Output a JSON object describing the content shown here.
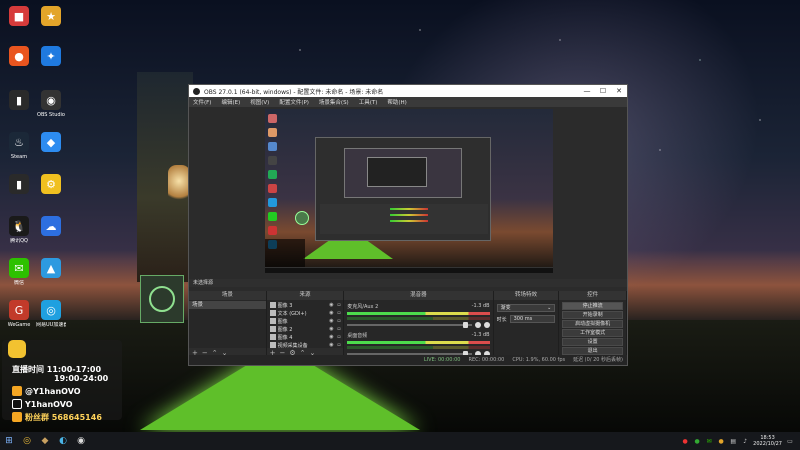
{
  "desktop": {
    "icons": [
      {
        "name": "desktop-icon-1",
        "label": "",
        "color": "#d63b3b",
        "glyph": "■"
      },
      {
        "name": "desktop-icon-2",
        "label": "",
        "color": "#e3a52a",
        "glyph": "★"
      },
      {
        "name": "desktop-icon-3",
        "label": "",
        "color": "#e9551f",
        "glyph": "●"
      },
      {
        "name": "desktop-icon-4",
        "label": "",
        "color": "#1f7ae0",
        "glyph": "✦"
      },
      {
        "name": "desktop-icon-5",
        "label": "",
        "color": "#2a2a2a",
        "glyph": "▮"
      },
      {
        "name": "desktop-icon-6",
        "label": "OBS Studio",
        "color": "#333333",
        "glyph": "◉"
      },
      {
        "name": "desktop-icon-7",
        "label": "Steam",
        "color": "#1b2838",
        "glyph": "♨"
      },
      {
        "name": "desktop-icon-8",
        "label": "",
        "color": "#2d8cf0",
        "glyph": "◆"
      },
      {
        "name": "desktop-icon-9",
        "label": "",
        "color": "#2a2a2a",
        "glyph": "▮"
      },
      {
        "name": "desktop-icon-10",
        "label": "",
        "color": "#f0c020",
        "glyph": "⚙"
      },
      {
        "name": "desktop-icon-11",
        "label": "腾讯QQ",
        "color": "#1a1a1a",
        "glyph": "🐧"
      },
      {
        "name": "desktop-icon-12",
        "label": "",
        "color": "#2d6fe0",
        "glyph": "☁"
      },
      {
        "name": "desktop-icon-13",
        "label": "微信",
        "color": "#2dc100",
        "glyph": "✉"
      },
      {
        "name": "desktop-icon-14",
        "label": "",
        "color": "#2d9ae0",
        "glyph": "▲"
      },
      {
        "name": "desktop-icon-15",
        "label": "WeGame",
        "color": "#c23a2a",
        "glyph": "G"
      },
      {
        "name": "desktop-icon-16",
        "label": "网易UU加速器",
        "color": "#1fa0e0",
        "glyph": "◎"
      }
    ]
  },
  "obs": {
    "title": "OBS 27.0.1 (64-bit, windows) - 配置文件: 未命名 - 场景: 未命名",
    "menu": [
      "文件(F)",
      "编辑(E)",
      "视图(V)",
      "配置文件(P)",
      "场景集合(S)",
      "工具(T)",
      "帮助(H)"
    ],
    "scene_bar_label": "未选择源",
    "panels": {
      "scenes": {
        "title": "场景",
        "items": [
          "场景"
        ]
      },
      "sources": {
        "title": "来源",
        "items": [
          {
            "label": "图像 3"
          },
          {
            "label": "文本 (GDI+)"
          },
          {
            "label": "图像"
          },
          {
            "label": "图像 2"
          },
          {
            "label": "图像 4"
          },
          {
            "label": "视频采集设备"
          },
          {
            "label": "窗口采"
          }
        ]
      },
      "mixer": {
        "title": "混音器",
        "channels": [
          {
            "name": "麦克风/Aux 2",
            "db": "-1.3 dB"
          },
          {
            "name": "桌面音频",
            "db": "-1.3 dB"
          }
        ]
      },
      "transitions": {
        "title": "转场特效",
        "selected": "渐变",
        "duration_label": "时长",
        "duration": "300 ms"
      },
      "controls": {
        "title": "控件",
        "buttons": [
          "停止推流",
          "开始录制",
          "启动虚拟摄像机",
          "工作室模式",
          "设置",
          "退出"
        ]
      }
    },
    "status": {
      "live": "LIVE: 00:00:00",
      "rec": "REC: 00:00:00",
      "cpu": "CPU: 1.9%, 60.00 fps",
      "dropped": "延迟 (0/ 20 秒后丢帧)"
    },
    "window_buttons": [
      "—",
      "☐",
      "✕"
    ]
  },
  "stream_card": {
    "time_label": "直播时间",
    "time1": "11:00-17:00",
    "time2": "19:00-24:00",
    "handle1": "@Y1hanOVO",
    "handle2": "Y1hanOVO",
    "fans": "粉丝群 568645146"
  },
  "taskbar": {
    "date": "2022/10/27",
    "time": "18:53",
    "icons": [
      "windows-start-icon",
      "chrome-icon",
      "game-icon",
      "edge-icon",
      "obs-icon"
    ]
  }
}
